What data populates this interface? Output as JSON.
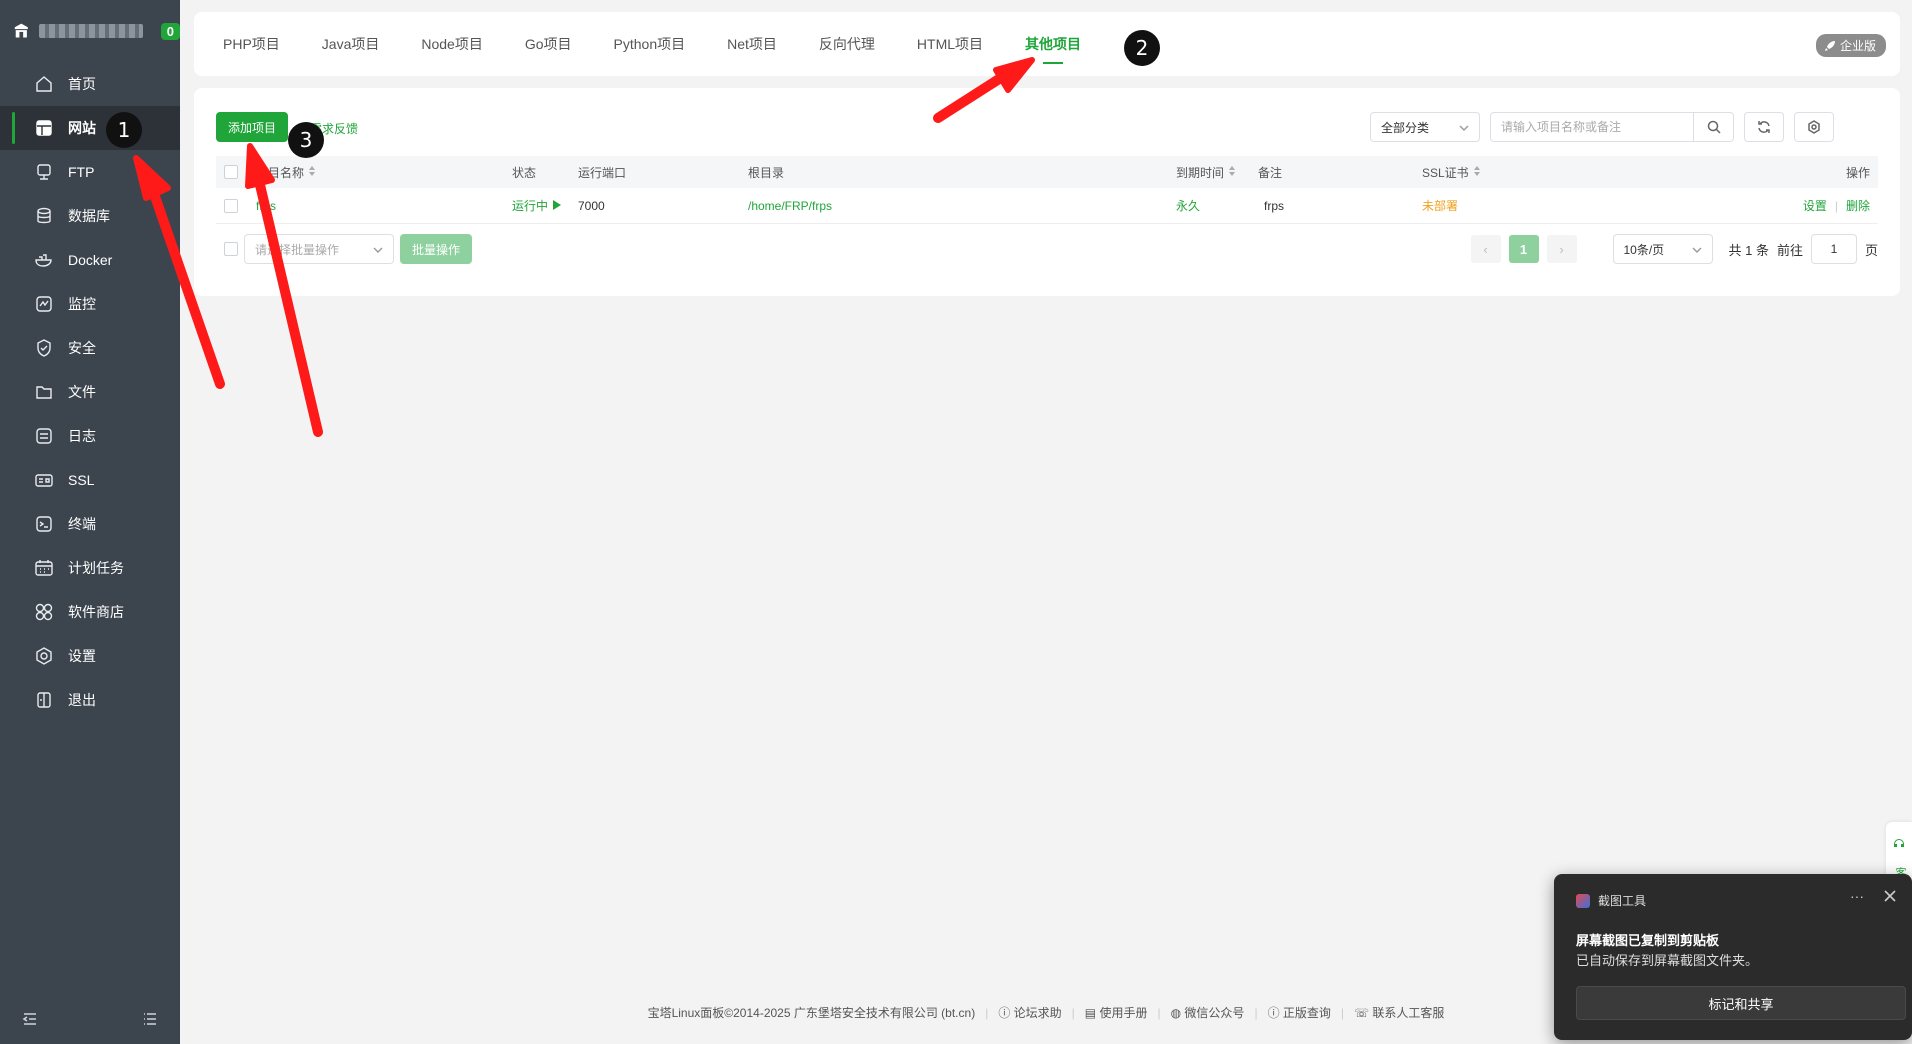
{
  "sidebar": {
    "notif_count": "0",
    "items": [
      {
        "label": "首页",
        "icon": "home-icon"
      },
      {
        "label": "网站",
        "icon": "website-icon",
        "active": true
      },
      {
        "label": "FTP",
        "icon": "ftp-icon"
      },
      {
        "label": "数据库",
        "icon": "database-icon"
      },
      {
        "label": "Docker",
        "icon": "docker-icon"
      },
      {
        "label": "监控",
        "icon": "monitor-icon"
      },
      {
        "label": "安全",
        "icon": "shield-icon"
      },
      {
        "label": "文件",
        "icon": "folder-icon"
      },
      {
        "label": "日志",
        "icon": "log-icon"
      },
      {
        "label": "SSL",
        "icon": "ssl-icon"
      },
      {
        "label": "终端",
        "icon": "terminal-icon"
      },
      {
        "label": "计划任务",
        "icon": "calendar-icon"
      },
      {
        "label": "软件商店",
        "icon": "apps-icon"
      },
      {
        "label": "设置",
        "icon": "gear-icon"
      },
      {
        "label": "退出",
        "icon": "logout-icon"
      }
    ]
  },
  "tabs": [
    "PHP项目",
    "Java项目",
    "Node项目",
    "Go项目",
    "Python项目",
    "Net项目",
    "反向代理",
    "HTML项目",
    "其他项目"
  ],
  "active_tab": "其他项目",
  "enterprise_badge": "企业版",
  "toolbar": {
    "add_label": "添加项目",
    "feedback_label": "需求反馈",
    "category_value": "全部分类",
    "search_placeholder": "请输入项目名称或备注"
  },
  "table": {
    "headers": {
      "name": "项目名称",
      "status": "状态",
      "port": "运行端口",
      "root": "根目录",
      "expire": "到期时间",
      "remark": "备注",
      "ssl": "SSL证书",
      "actions": "操作"
    },
    "rows": [
      {
        "name": "frps",
        "status": "运行中",
        "port": "7000",
        "root": "/home/FRP/frps",
        "expire": "永久",
        "remark": "frps",
        "ssl": "未部署",
        "action_settings": "设置",
        "action_delete": "删除"
      }
    ]
  },
  "batch": {
    "placeholder": "请选择批量操作",
    "button": "批量操作"
  },
  "pagination": {
    "current": "1",
    "page_size": "10条/页",
    "total_text": "共 1 条",
    "goto_label": "前往",
    "goto_value": "1",
    "page_unit": "页"
  },
  "footer": {
    "copyright": "宝塔Linux面板©2014-2025 广东堡塔安全技术有限公司 (bt.cn)",
    "links": [
      "论坛求助",
      "使用手册",
      "微信公众号",
      "正版查询",
      "联系人工客服"
    ]
  },
  "float_tab": "客服",
  "toast": {
    "app": "截图工具",
    "title": "屏幕截图已复制到剪贴板",
    "body": "已自动保存到屏幕截图文件夹。",
    "button": "标记和共享",
    "more": "···"
  },
  "markers": [
    "1",
    "2",
    "3"
  ],
  "colors": {
    "accent": "#20a53a",
    "sidebar_bg": "#3c444d",
    "warning": "#f0a020",
    "annotation_arrow": "#ff1a1a"
  }
}
